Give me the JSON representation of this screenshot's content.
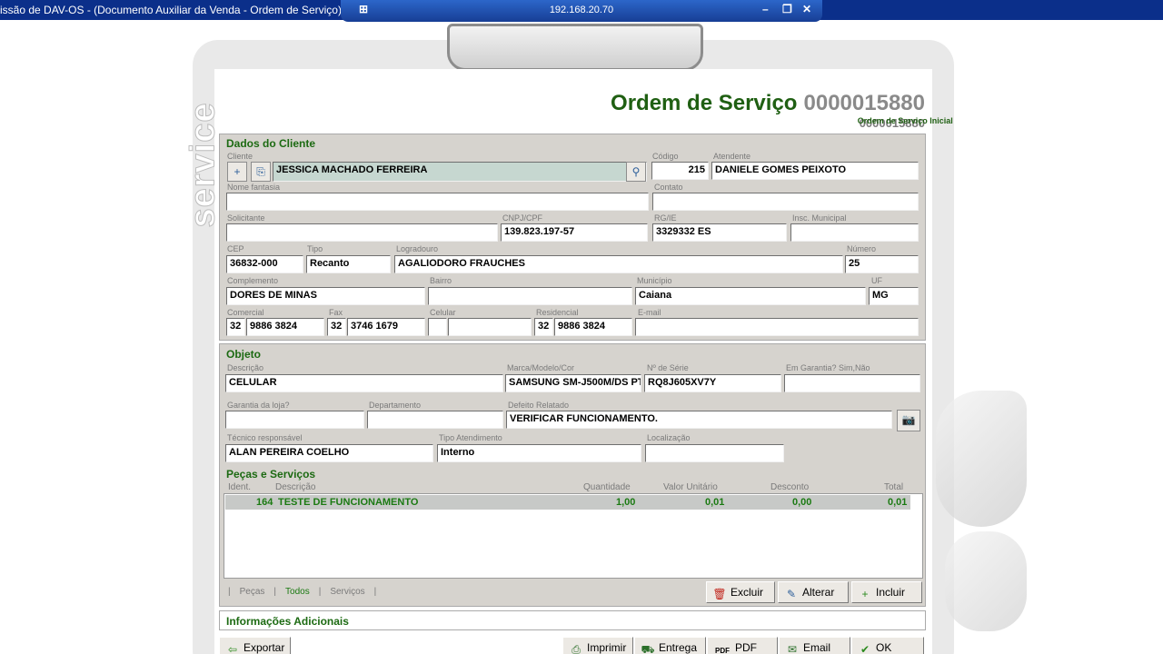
{
  "window": {
    "title": "issão de DAV-OS - (Documento Auxiliar da Venda - Ordem de Serviço)",
    "remote_host": "192.168.20.70"
  },
  "watermark": "service",
  "header": {
    "title": "Ordem de Serviço",
    "number": "0000015880",
    "sub_label": "Ordem de Serviço Inicial",
    "sub_number": "0000015880"
  },
  "cliente": {
    "section_title": "Dados do Cliente",
    "labels": {
      "cliente": "Cliente",
      "codigo": "Código",
      "atendente": "Atendente",
      "nome_fantasia": "Nome fantasia",
      "contato": "Contato",
      "solicitante": "Solicitante",
      "cnpj": "CNPJ/CPF",
      "rg": "RG/IE",
      "insc": "Insc. Municipal",
      "cep": "CEP",
      "tipo": "Tipo",
      "logradouro": "Logradouro",
      "numero": "Número",
      "complemento": "Complemento",
      "bairro": "Bairro",
      "municipio": "Município",
      "uf": "UF",
      "comercial": "Comercial",
      "fax": "Fax",
      "celular": "Celular",
      "residencial": "Residencial",
      "email": "E-mail"
    },
    "values": {
      "cliente": "JESSICA MACHADO FERREIRA",
      "codigo": "215",
      "atendente": "DANIELE GOMES PEIXOTO",
      "nome_fantasia": "",
      "contato": "",
      "solicitante": "",
      "cnpj": "139.823.197-57",
      "rg": "3329332 ES",
      "insc": "",
      "cep": "36832-000",
      "tipo": "Recanto",
      "logradouro": "AGALIODORO FRAUCHES",
      "numero": "25",
      "complemento": "DORES DE MINAS",
      "bairro": "",
      "municipio": "Caiana",
      "uf": "MG",
      "comercial_ddd": "32",
      "comercial": "9886 3824",
      "fax_ddd": "32",
      "fax": "3746 1679",
      "celular_ddd": "",
      "celular": "",
      "residencial_ddd": "32",
      "residencial": "9886 3824",
      "email": ""
    }
  },
  "objeto": {
    "section_title": "Objeto",
    "labels": {
      "descricao": "Descrição",
      "marca": "Marca/Modelo/Cor",
      "serie": "Nº de Série",
      "garantia": "Em Garantia? Sim,Não",
      "garantia_loja": "Garantia da loja?",
      "departamento": "Departamento",
      "defeito": "Defeito Relatado",
      "tecnico": "Técnico responsável",
      "tipo_atendimento": "Tipo Atendimento",
      "localizacao": "Localização"
    },
    "values": {
      "descricao": "CELULAR",
      "marca": "SAMSUNG SM-J500M/DS PT",
      "serie": "RQ8J605XV7Y",
      "garantia": "",
      "garantia_loja": "",
      "departamento": "",
      "defeito": "VERIFICAR FUNCIONAMENTO.",
      "tecnico": "ALAN PEREIRA COELHO",
      "tipo_atendimento": "Interno",
      "localizacao": ""
    }
  },
  "pecas": {
    "section_title": "Peças e Serviços",
    "columns": [
      "Ident.",
      "Descrição",
      "Quantidade",
      "Valor Unitário",
      "Desconto",
      "Total"
    ],
    "rows": [
      {
        "ident": "164",
        "descricao": "TESTE DE FUNCIONAMENTO",
        "quantidade": "1,00",
        "valor": "0,01",
        "desconto": "0,00",
        "total": "0,01"
      }
    ],
    "filters": [
      "Peças",
      "Todos",
      "Serviços"
    ],
    "buttons": {
      "excluir": "Excluir",
      "alterar": "Alterar",
      "incluir": "Incluir"
    }
  },
  "info_adicionais": "Informações Adicionais",
  "footer_buttons": {
    "exportar": "Exportar",
    "imprimir": "Imprimir",
    "entrega": "Entrega",
    "pdf": "PDF",
    "email": "Email",
    "ok": "OK",
    "pdf_icon": "PDF"
  },
  "colors": {
    "accent_green": "#1c6a12",
    "titlebar": "#0b2f8a",
    "panel": "#d6d3ce"
  }
}
